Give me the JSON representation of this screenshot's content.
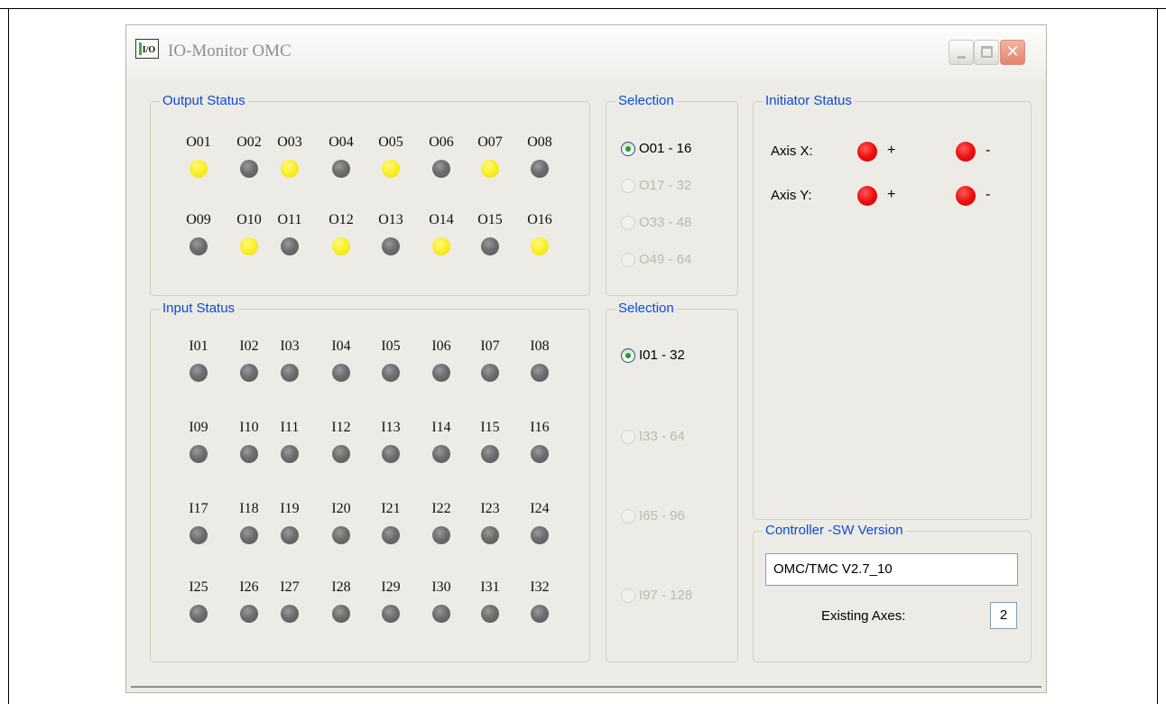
{
  "window": {
    "title": "IO-Monitor OMC",
    "icon": "I/O"
  },
  "output_status": {
    "label": "Output Status",
    "leds": [
      {
        "name": "O01",
        "on": true
      },
      {
        "name": "O02",
        "on": false
      },
      {
        "name": "O03",
        "on": true
      },
      {
        "name": "O04",
        "on": false
      },
      {
        "name": "O05",
        "on": true
      },
      {
        "name": "O06",
        "on": false
      },
      {
        "name": "O07",
        "on": true
      },
      {
        "name": "O08",
        "on": false
      },
      {
        "name": "O09",
        "on": false
      },
      {
        "name": "O10",
        "on": true
      },
      {
        "name": "O11",
        "on": false
      },
      {
        "name": "O12",
        "on": true
      },
      {
        "name": "O13",
        "on": false
      },
      {
        "name": "O14",
        "on": true
      },
      {
        "name": "O15",
        "on": false
      },
      {
        "name": "O16",
        "on": true
      }
    ]
  },
  "input_status": {
    "label": "Input Status",
    "leds": [
      {
        "name": "I01",
        "on": false
      },
      {
        "name": "I02",
        "on": false
      },
      {
        "name": "I03",
        "on": false
      },
      {
        "name": "I04",
        "on": false
      },
      {
        "name": "I05",
        "on": false
      },
      {
        "name": "I06",
        "on": false
      },
      {
        "name": "I07",
        "on": false
      },
      {
        "name": "I08",
        "on": false
      },
      {
        "name": "I09",
        "on": false
      },
      {
        "name": "I10",
        "on": false
      },
      {
        "name": "I11",
        "on": false
      },
      {
        "name": "I12",
        "on": false
      },
      {
        "name": "I13",
        "on": false
      },
      {
        "name": "I14",
        "on": false
      },
      {
        "name": "I15",
        "on": false
      },
      {
        "name": "I16",
        "on": false
      },
      {
        "name": "I17",
        "on": false
      },
      {
        "name": "I18",
        "on": false
      },
      {
        "name": "I19",
        "on": false
      },
      {
        "name": "I20",
        "on": false
      },
      {
        "name": "I21",
        "on": false
      },
      {
        "name": "I22",
        "on": false
      },
      {
        "name": "I23",
        "on": false
      },
      {
        "name": "I24",
        "on": false
      },
      {
        "name": "I25",
        "on": false
      },
      {
        "name": "I26",
        "on": false
      },
      {
        "name": "I27",
        "on": false
      },
      {
        "name": "I28",
        "on": false
      },
      {
        "name": "I29",
        "on": false
      },
      {
        "name": "I30",
        "on": false
      },
      {
        "name": "I31",
        "on": false
      },
      {
        "name": "I32",
        "on": false
      }
    ]
  },
  "output_selection": {
    "label": "Selection",
    "options": [
      {
        "label": "O01 - 16",
        "checked": true,
        "enabled": true
      },
      {
        "label": "O17 - 32",
        "checked": false,
        "enabled": false
      },
      {
        "label": "O33 - 48",
        "checked": false,
        "enabled": false
      },
      {
        "label": "O49 - 64",
        "checked": false,
        "enabled": false
      }
    ]
  },
  "input_selection": {
    "label": "Selection",
    "options": [
      {
        "label": "I01 - 32",
        "checked": true,
        "enabled": true
      },
      {
        "label": "I33 - 64",
        "checked": false,
        "enabled": false
      },
      {
        "label": "I65 - 96",
        "checked": false,
        "enabled": false
      },
      {
        "label": "I97 - 128",
        "checked": false,
        "enabled": false
      }
    ]
  },
  "initiator_status": {
    "label": "Initiator Status",
    "axes": [
      {
        "label": "Axis X:",
        "plus": "+",
        "minus": "-",
        "plus_active": true,
        "minus_active": true
      },
      {
        "label": "Axis Y:",
        "plus": "+",
        "minus": "-",
        "plus_active": true,
        "minus_active": true
      }
    ]
  },
  "controller": {
    "label": "Controller -SW Version",
    "version": "OMC/TMC V2.7_10",
    "existing_axes_label": "Existing Axes:",
    "existing_axes_value": "2"
  },
  "colors": {
    "led_on": "#fbf02a",
    "led_off": "#6d6d6d",
    "initiator_active": "#ee1010",
    "group_label": "#0b4bd6"
  }
}
